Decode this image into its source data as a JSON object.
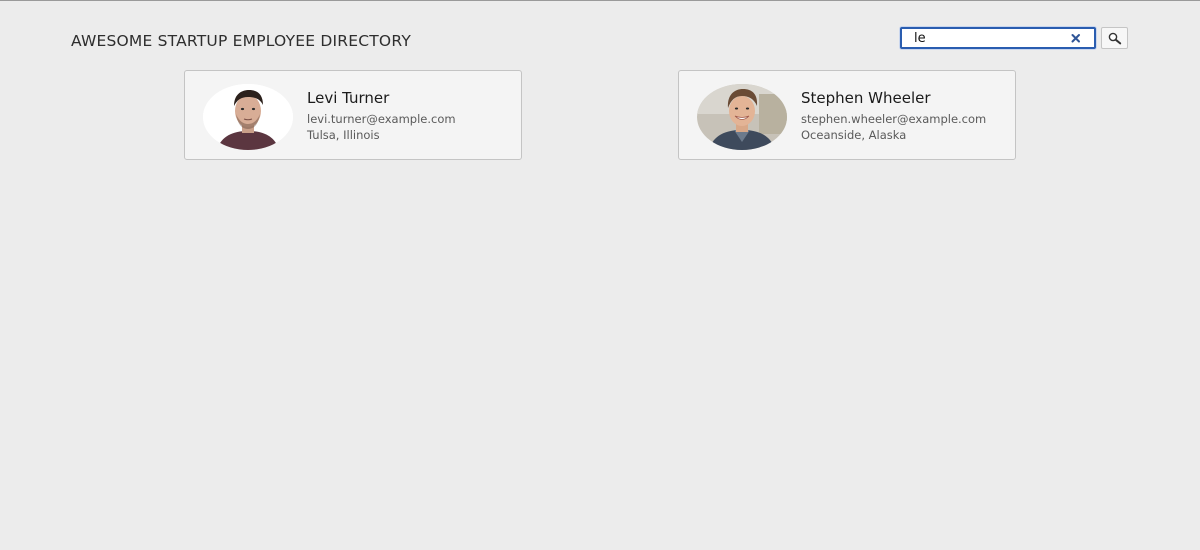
{
  "header": {
    "title": "AWESOME STARTUP EMPLOYEE DIRECTORY"
  },
  "search": {
    "value": "le",
    "clear_icon": "close-icon",
    "button_icon": "magnifier-icon",
    "accent_color": "#2a5db0"
  },
  "employees": [
    {
      "name": "Levi Turner",
      "email": "levi.turner@example.com",
      "location": "Tulsa, Illinois"
    },
    {
      "name": "Stephen Wheeler",
      "email": "stephen.wheeler@example.com",
      "location": "Oceanside, Alaska"
    }
  ]
}
